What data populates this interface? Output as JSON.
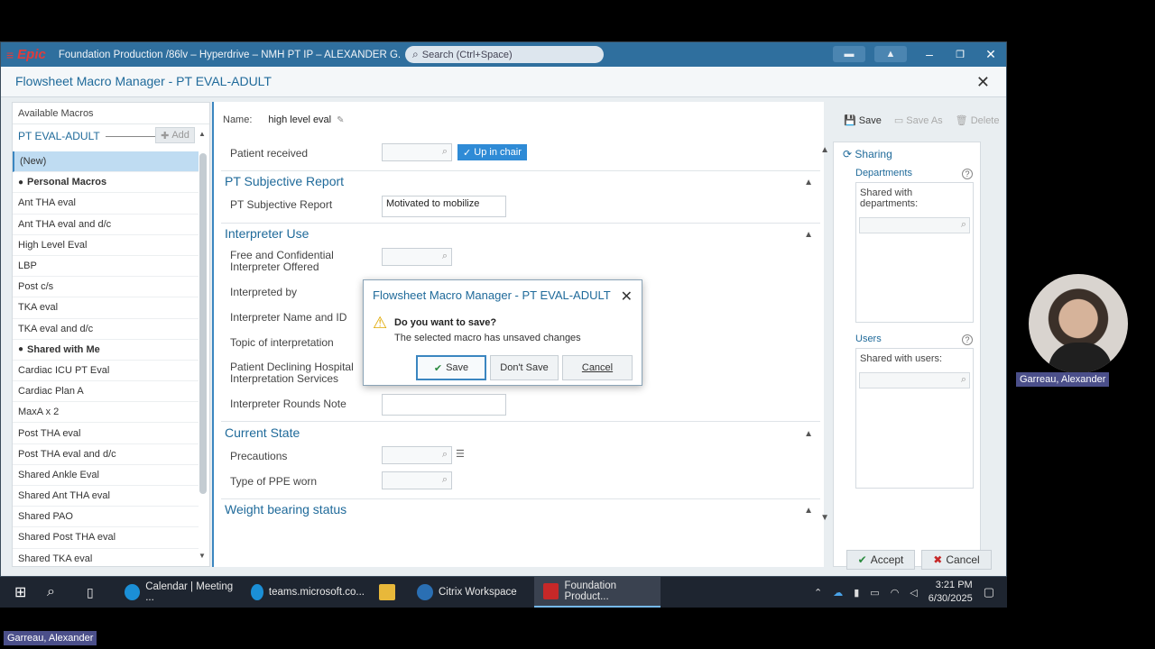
{
  "window": {
    "title": "Foundation Production /86lv – Hyperdrive – NMH PT IP – ALEXANDER G.",
    "search_placeholder": "Search (Ctrl+Space)"
  },
  "dialog": {
    "title": "Flowsheet Macro Manager - PT EVAL-ADULT"
  },
  "left_panel": {
    "header": "Available Macros",
    "macro_type": "PT EVAL-ADULT",
    "add_label": "Add",
    "items": [
      {
        "label": "(New)",
        "kind": "item"
      },
      {
        "label": "Personal Macros",
        "kind": "group"
      },
      {
        "label": "Ant THA eval",
        "kind": "item"
      },
      {
        "label": "Ant THA eval and d/c",
        "kind": "item"
      },
      {
        "label": "High Level Eval",
        "kind": "item"
      },
      {
        "label": "LBP",
        "kind": "item"
      },
      {
        "label": "Post c/s",
        "kind": "item"
      },
      {
        "label": "TKA eval",
        "kind": "item"
      },
      {
        "label": "TKA eval and d/c",
        "kind": "item"
      },
      {
        "label": "Shared with Me",
        "kind": "group"
      },
      {
        "label": "Cardiac ICU PT Eval",
        "kind": "item"
      },
      {
        "label": "Cardiac Plan A",
        "kind": "item"
      },
      {
        "label": "MaxA x 2",
        "kind": "item"
      },
      {
        "label": "Post THA eval",
        "kind": "item"
      },
      {
        "label": "Post THA eval and d/c",
        "kind": "item"
      },
      {
        "label": "Shared Ankle Eval",
        "kind": "item"
      },
      {
        "label": "Shared Ant THA eval",
        "kind": "item"
      },
      {
        "label": "Shared PAO",
        "kind": "item"
      },
      {
        "label": "Shared Post THA eval",
        "kind": "item"
      },
      {
        "label": "Shared TKA eval",
        "kind": "item"
      }
    ]
  },
  "form": {
    "name_label": "Name:",
    "name_value": "high level eval",
    "patient_received_label": "Patient received",
    "patient_received_chip": "Up in chair",
    "sections": {
      "subjective": "PT Subjective Report",
      "interpreter": "Interpreter Use",
      "current_state": "Current State",
      "weight_bearing": "Weight bearing status"
    },
    "subjective_label": "PT Subjective Report",
    "subjective_value": "Motivated to mobilize",
    "free_interp_label": "Free and Confidential Interpreter Offered",
    "interpreted_by_label": "Interpreted by",
    "interp_name_label": "Interpreter Name and ID",
    "topic_label": "Topic of interpretation",
    "declining_label": "Patient Declining Hospital Interpretation Services",
    "rounds_note_label": "Interpreter Rounds Note",
    "precautions_label": "Precautions",
    "ppe_label": "Type of PPE worn"
  },
  "top_actions": {
    "save": "Save",
    "save_as": "Save As",
    "delete": "Delete"
  },
  "sharing": {
    "title": "Sharing",
    "departments": "Departments",
    "shared_with_departments": "Shared with departments:",
    "users": "Users",
    "shared_with_users": "Shared with users:"
  },
  "bottom": {
    "accept": "Accept",
    "cancel": "Cancel"
  },
  "modal": {
    "title": "Flowsheet Macro Manager - PT EVAL-ADULT",
    "question": "Do you want to save?",
    "message": "The selected macro has unsaved changes",
    "save": "Save",
    "dont_save": "Don't Save",
    "cancel": "Cancel"
  },
  "participant": {
    "name_tag": "Garreau, Alexander",
    "self_tag": "Garreau, Alexander"
  },
  "taskbar": {
    "apps": [
      {
        "label": "Calendar | Meeting ...",
        "icon": "edge-icon"
      },
      {
        "label": "teams.microsoft.co...",
        "icon": "edge-icon"
      },
      {
        "label": "",
        "icon": "file-explorer-icon"
      },
      {
        "label": "Citrix Workspace",
        "icon": "citrix-icon"
      },
      {
        "label": "Foundation Product...",
        "icon": "epic-icon"
      }
    ],
    "time": "3:21 PM",
    "date": "6/30/2025"
  }
}
